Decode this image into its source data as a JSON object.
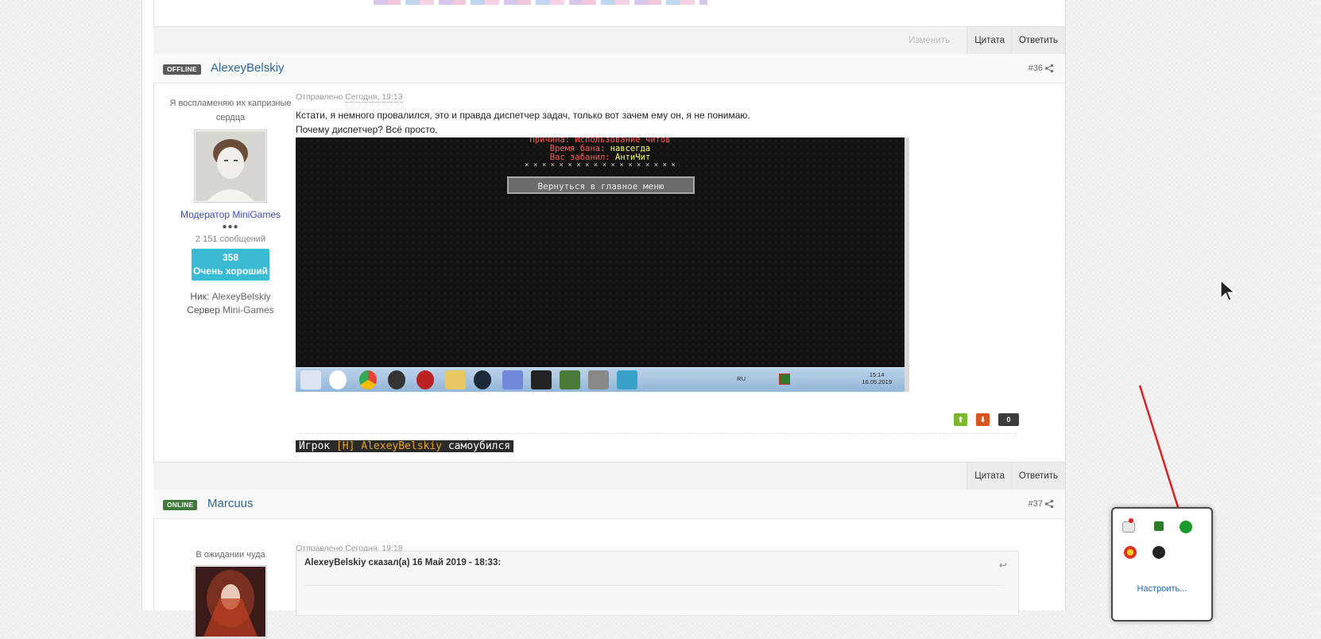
{
  "post_prev": {
    "actions": {
      "edit": "Изменить",
      "quote": "Цитата",
      "reply": "Ответить"
    }
  },
  "post36": {
    "status": "OFFLINE",
    "author": "AlexeyBelskiy",
    "number": "#36",
    "user_title": "Я воспламеняю их капризные сердца",
    "rank": "Модератор MiniGames",
    "dots": "●●●",
    "messages": "2 151 сообщений",
    "reputation_value": "358",
    "reputation_label": "Очень хороший",
    "nick_label": "Ник:",
    "nick_value": "AlexeyBelskiy",
    "server_label": "Сервер",
    "server_value": "Mini-Games",
    "sent_label": "Отправлено",
    "sent_time": "Сегодня, 19:13",
    "text_line1": "Кстати, я немного провалился, это и правда диспетчер задач, только вот зачем ему он, я не понимаю.",
    "text_line2": "Почему диспетчер? Всё просто,",
    "screenshot": {
      "line1": "Причина: Использование читов",
      "line2_label": "Время бана:",
      "line2_value": "навсегда",
      "line3_label": "Вас забанил:",
      "line3_value": "АнтиЧит",
      "stars": "× × × × × × × × × × × × × × × × × ×",
      "button": "Вернуться в главное меню",
      "tray_lang": "RU",
      "tray_time": "15:14",
      "tray_date": "16.05.2019"
    },
    "votes": {
      "up": "⬆",
      "down": "⬇",
      "count": "0"
    },
    "signature_prefix": "Игрок ",
    "signature_name": "[Н] AlexeyBelskiy",
    "signature_suffix": " самоубился",
    "actions": {
      "quote": "Цитата",
      "reply": "Ответить"
    }
  },
  "post37": {
    "status": "ONLINE",
    "author": "Marcuus",
    "number": "#37",
    "user_title": "В ожидании чуда",
    "sent_label": "Отправлено",
    "sent_time": "Сегодня, 19:18",
    "quote_header": "AlexeyBelskiy сказал(а) 16 Май 2019 - 18:33:"
  },
  "tray_popup": {
    "link": "Настроить..."
  },
  "colors": {
    "link": "#2b6699",
    "rep": "#3bbad4",
    "online": "#3f7a3a",
    "offline": "#5a5a5a",
    "arrow": "#e02020"
  }
}
